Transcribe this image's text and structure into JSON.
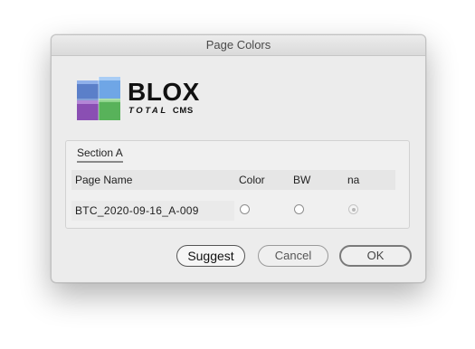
{
  "window": {
    "title": "Page Colors"
  },
  "logo": {
    "word": "BLOX",
    "sub_total": "TOTAL",
    "sub_cms": "CMS"
  },
  "section": {
    "tab_label": "Section A",
    "columns": {
      "page_name": "Page Name",
      "color": "Color",
      "bw": "BW",
      "na": "na"
    },
    "rows": [
      {
        "page_name": "BTC_2020-09-16_A-009",
        "selected": "na"
      }
    ]
  },
  "buttons": {
    "suggest": "Suggest",
    "cancel": "Cancel",
    "ok": "OK"
  }
}
